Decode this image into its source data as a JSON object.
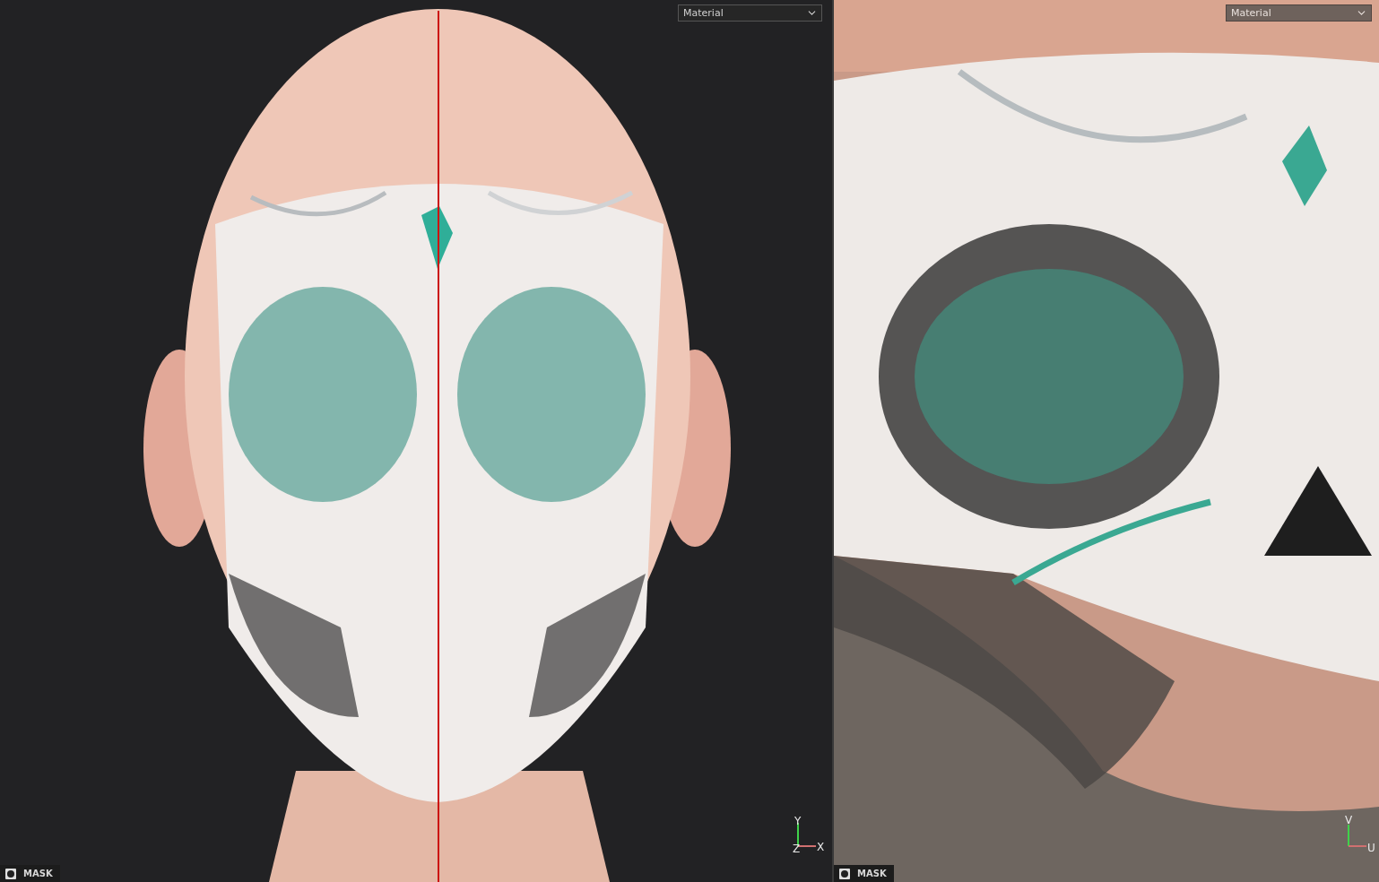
{
  "viewports": [
    {
      "kind": "model",
      "dropdown": {
        "value": "Material"
      },
      "axis_labels": [
        "Y",
        "Z",
        "X"
      ],
      "mask_label": "MASK"
    },
    {
      "kind": "uv",
      "dropdown": {
        "value": "Material"
      },
      "axis_labels": [
        "V",
        "U"
      ],
      "mask_label": "MASK"
    }
  ]
}
